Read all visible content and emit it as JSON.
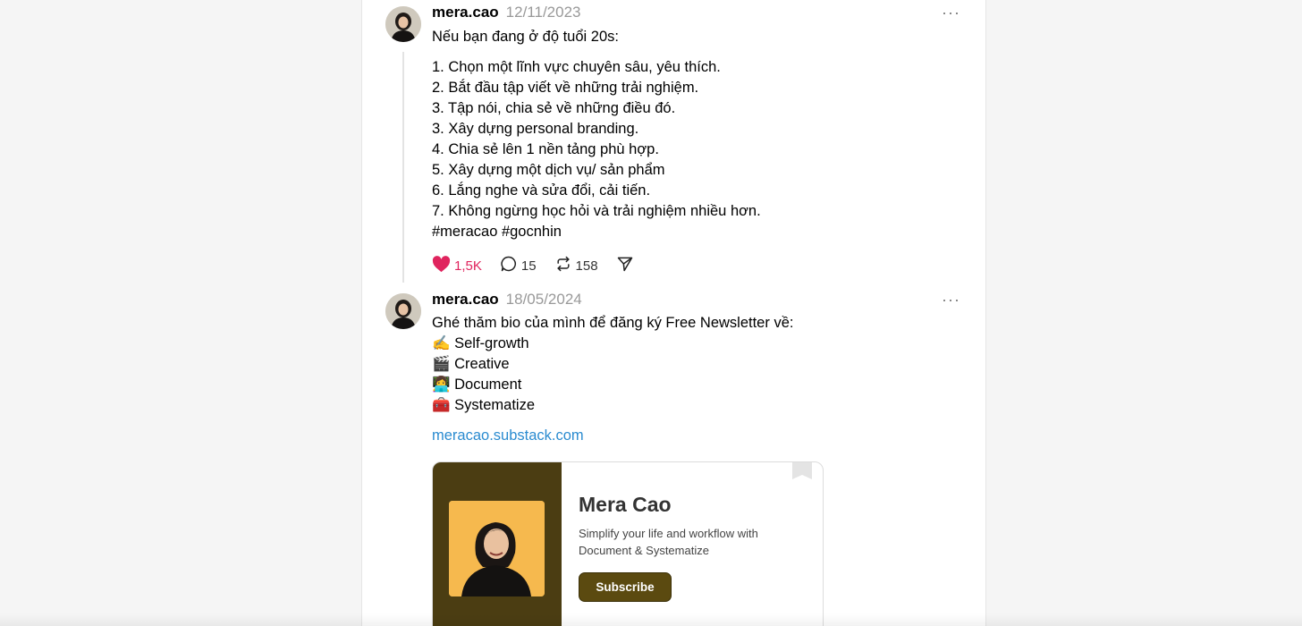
{
  "posts": [
    {
      "username": "mera.cao",
      "date": "12/11/2023",
      "more_label": "···",
      "lines": [
        "Nếu bạn đang ở độ tuổi 20s:",
        "1. Chọn một lĩnh vực chuyên sâu, yêu thích.",
        "2. Bắt đầu tập viết về những trải nghiệm.",
        "3. Tập nói, chia sẻ về những điều đó.",
        "3. Xây dựng personal branding.",
        "4. Chia sẻ lên 1 nền tảng phù hợp.",
        "5. Xây dựng một dịch vụ/ sản phẩm",
        "6. Lắng nghe và sửa đổi, cải tiến.",
        "7. Không ngừng học hỏi và trải nghiệm nhiều hơn.",
        "#meracao #gocnhin"
      ],
      "likes": "1,5K",
      "comments": "15",
      "reposts": "158",
      "icons": {
        "like": "heart-icon",
        "comment": "comment-icon",
        "repost": "repost-icon",
        "share": "send-icon"
      },
      "like_color": "#e0245e"
    },
    {
      "username": "mera.cao",
      "date": "18/05/2024",
      "more_label": "···",
      "lines": [
        "Ghé thăm bio của mình để đăng ký Free Newsletter về:",
        "✍️ Self-growth",
        "🎬 Creative",
        "👩‍💻 Document",
        "🧰 Systematize"
      ],
      "link": "meracao.substack.com",
      "link_color": "#2a8bd0",
      "card": {
        "title": "Mera Cao",
        "description": "Simplify your life and workflow with Document & Systematize",
        "subscribe_label": "Subscribe",
        "accent": "#4b3d12",
        "photo_bg": "#f6b94e"
      }
    }
  ]
}
